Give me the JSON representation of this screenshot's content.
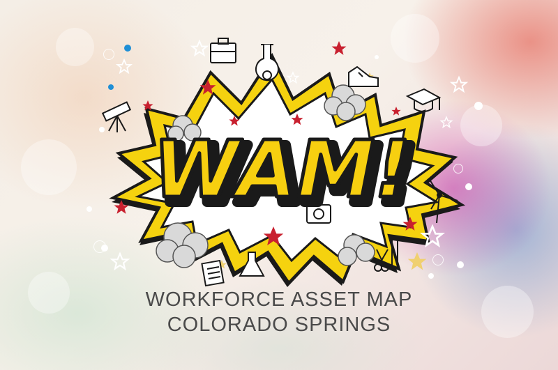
{
  "logo": {
    "wordmark": "WAM!"
  },
  "tagline": {
    "line1": "WORKFORCE ASSET MAP",
    "line2": "COLORADO SPRINGS"
  },
  "colors": {
    "burst_yellow": "#f5d20f",
    "text_yellow": "#f7cf10",
    "outline": "#1a1a1a",
    "star_red": "#c8202f",
    "dot_blue": "#1f8fd6",
    "caption": "#4a4a4a"
  },
  "icons": [
    "briefcase-icon",
    "flask-icon",
    "sneaker-icon",
    "telescope-icon",
    "graduation-cap-icon",
    "camera-icon",
    "wind-turbine-icon",
    "notepad-icon",
    "beaker-icon",
    "scissors-comb-icon"
  ]
}
